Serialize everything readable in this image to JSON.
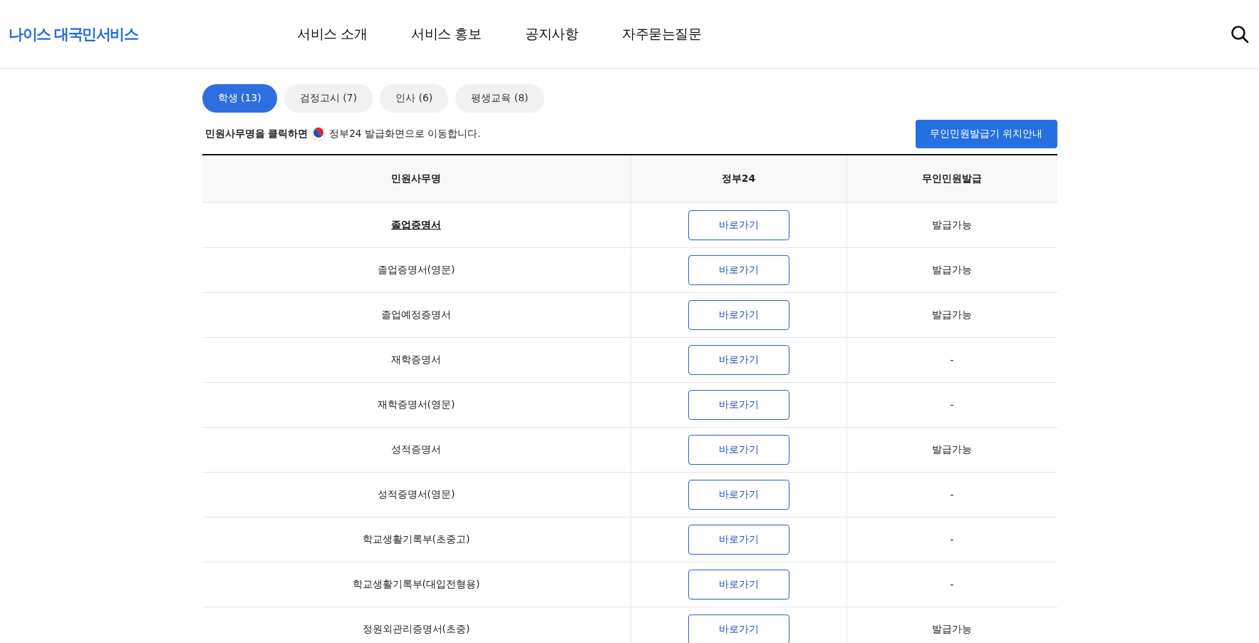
{
  "header": {
    "logo": "나이스 대국민서비스",
    "nav": [
      "서비스 소개",
      "서비스 홍보",
      "공지사항",
      "자주묻는질문"
    ]
  },
  "tabs": [
    {
      "label": "학생 (13)",
      "selected": true
    },
    {
      "label": "검정고시 (7)",
      "selected": false
    },
    {
      "label": "인사 (6)",
      "selected": false
    },
    {
      "label": "평생교육 (8)",
      "selected": false
    }
  ],
  "notice": {
    "before": "민원사무명을 클릭하면",
    "after": "정부24 발급화면으로 이동합니다."
  },
  "kiosk_button": "무인민원발급기 위치안내",
  "table": {
    "columns": [
      "민원사무명",
      "정부24",
      "무인민원발급"
    ],
    "rows": [
      {
        "name": "졸업증명서",
        "highlighted": true,
        "link": "바로가기",
        "kiosk": "발급가능"
      },
      {
        "name": "졸업증명서(영문)",
        "highlighted": false,
        "link": "바로가기",
        "kiosk": "발급가능"
      },
      {
        "name": "졸업예정증명서",
        "highlighted": false,
        "link": "바로가기",
        "kiosk": "발급가능"
      },
      {
        "name": "재학증명서",
        "highlighted": false,
        "link": "바로가기",
        "kiosk": "-"
      },
      {
        "name": "재학증명서(영문)",
        "highlighted": false,
        "link": "바로가기",
        "kiosk": "-"
      },
      {
        "name": "성적증명서",
        "highlighted": false,
        "link": "바로가기",
        "kiosk": "발급가능"
      },
      {
        "name": "성적증명서(영문)",
        "highlighted": false,
        "link": "바로가기",
        "kiosk": "-"
      },
      {
        "name": "학교생활기록부(초중고)",
        "highlighted": false,
        "link": "바로가기",
        "kiosk": "-"
      },
      {
        "name": "학교생활기록부(대입전형용)",
        "highlighted": false,
        "link": "바로가기",
        "kiosk": "-"
      },
      {
        "name": "정원외관리증명서(초중)",
        "highlighted": false,
        "link": "바로가기",
        "kiosk": "발급가능"
      }
    ]
  }
}
